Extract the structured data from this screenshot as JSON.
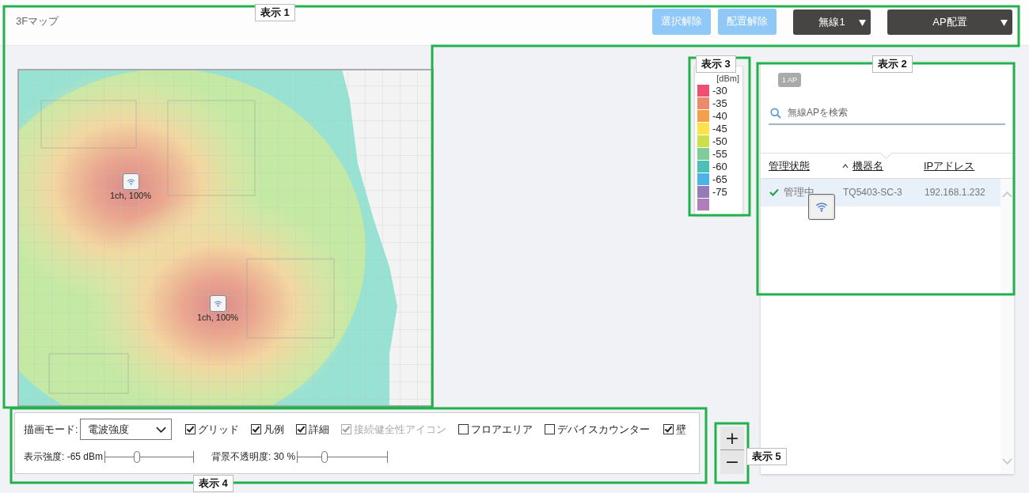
{
  "header": {
    "title": "3Fマップ",
    "buttons": [
      {
        "label": "選択解除",
        "kind": "light"
      },
      {
        "label": "配置解除",
        "kind": "light"
      },
      {
        "label": "無線1",
        "kind": "dropdown"
      },
      {
        "label": "AP配置",
        "kind": "dropdown"
      }
    ]
  },
  "map": {
    "access_points": [
      {
        "label": "1ch, 100%"
      },
      {
        "label": "1ch, 100%"
      }
    ]
  },
  "legend": {
    "unit": "[dBm]",
    "items": [
      {
        "label": "-30",
        "color": "#ef5071"
      },
      {
        "label": "-35",
        "color": "#ef896b"
      },
      {
        "label": "-40",
        "color": "#f4a04a"
      },
      {
        "label": "-45",
        "color": "#fde24b"
      },
      {
        "label": "-50",
        "color": "#cde04b"
      },
      {
        "label": "-55",
        "color": "#7dcc99"
      },
      {
        "label": "-60",
        "color": "#4cc0b6"
      },
      {
        "label": "-65",
        "color": "#4cb3e6"
      },
      {
        "label": "-75",
        "color": "#957cb6"
      },
      {
        "color": "#b07fb9"
      }
    ]
  },
  "ap_panel": {
    "badge": "1 AP",
    "search": {
      "placeholder": "無線APを検索"
    },
    "columns": [
      {
        "label": "管理状態",
        "sorted": false
      },
      {
        "label": "機器名",
        "sorted": true
      },
      {
        "label": "IPアドレス",
        "sorted": false
      }
    ],
    "rows": [
      {
        "selected": true,
        "managed": true,
        "status": "管理中",
        "name": "TQ5403-SC-3",
        "ip": "192.168.1.232"
      }
    ]
  },
  "controls": {
    "mode_label": "描画モード:",
    "mode": "電波強度",
    "checkboxes": [
      {
        "label": "グリッド",
        "checked": true,
        "disabled": false
      },
      {
        "label": "凡例",
        "checked": true,
        "disabled": false
      },
      {
        "label": "詳細",
        "checked": true,
        "disabled": false
      },
      {
        "label": "接続健全性アイコン",
        "checked": true,
        "disabled": true
      },
      {
        "label": "フロアエリア",
        "checked": false,
        "disabled": false
      },
      {
        "label": "デバイスカウンター",
        "checked": false,
        "disabled": false
      },
      {
        "label": "壁",
        "checked": true,
        "disabled": false
      }
    ],
    "sliders": [
      {
        "label": "表示強度: -65 dBm",
        "level": 0.36
      },
      {
        "label": "背景不透明度: 30 %",
        "level": 0.3
      }
    ]
  },
  "zoom": [
    "+",
    "−"
  ],
  "annotations": [
    {
      "label": "表示 1"
    },
    {
      "label": "表示 2"
    },
    {
      "label": "表示 3"
    },
    {
      "label": "表示 4"
    },
    {
      "label": "表示 5"
    }
  ]
}
